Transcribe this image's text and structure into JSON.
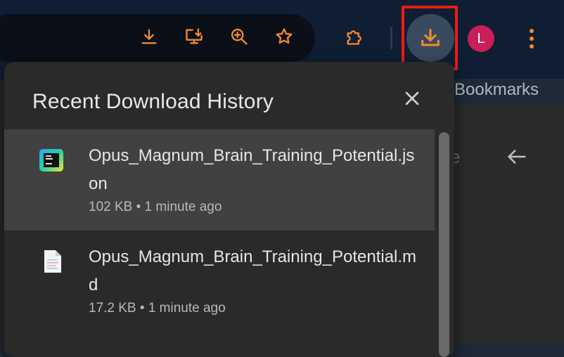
{
  "toolbar": {
    "icons": [
      "download-icon",
      "install-app-icon",
      "zoom-in-icon",
      "bookmark-star-icon",
      "extensions-icon",
      "downloads-active-icon",
      "menu-icon"
    ],
    "avatar_letter": "L",
    "accent_color": "#f28b2f"
  },
  "background": {
    "bookmarks_label": "Bookmarks",
    "partial_letter": "e"
  },
  "downloads_popup": {
    "title": "Recent Download History",
    "items": [
      {
        "file_name": "Opus_Magnum_Brain_Training_Potential.json",
        "size": "102 KB",
        "time": "1 minute ago",
        "icon": "json-file-icon"
      },
      {
        "file_name": "Opus_Magnum_Brain_Training_Potential.md",
        "size": "17.2 KB",
        "time": "1 minute ago",
        "icon": "text-file-icon"
      }
    ]
  }
}
